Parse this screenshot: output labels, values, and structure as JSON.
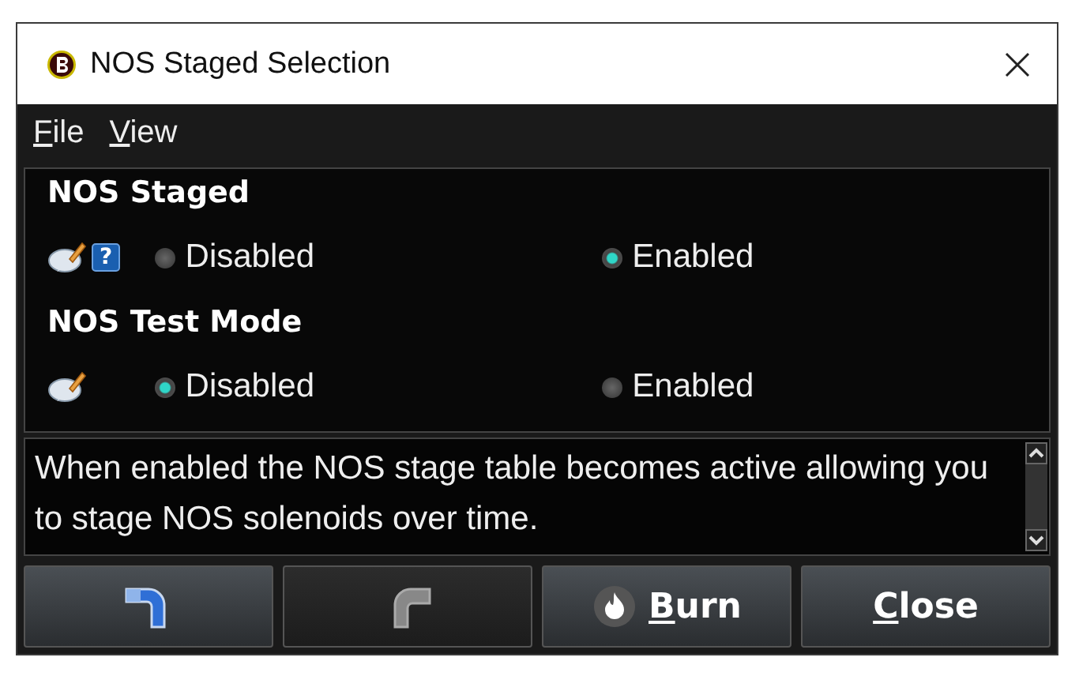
{
  "window": {
    "title": "NOS Staged Selection"
  },
  "menu": [
    {
      "mnemonic": "F",
      "rest": "ile"
    },
    {
      "mnemonic": "V",
      "rest": "iew"
    }
  ],
  "settings": [
    {
      "label": "NOS Staged",
      "has_help": true,
      "help_glyph": "?",
      "options": [
        {
          "label": "Disabled",
          "selected": false
        },
        {
          "label": "Enabled",
          "selected": true
        }
      ]
    },
    {
      "label": "NOS Test Mode",
      "has_help": false,
      "options": [
        {
          "label": "Disabled",
          "selected": true
        },
        {
          "label": "Enabled",
          "selected": false
        }
      ]
    }
  ],
  "help_text": "When enabled the NOS stage table becomes active allowing you to stage NOS solenoids over time.",
  "buttons": [
    {
      "kind": "undo",
      "disabled": false
    },
    {
      "kind": "redo",
      "disabled": true
    },
    {
      "kind": "burn",
      "mnemonic": "B",
      "rest": "urn",
      "disabled": false
    },
    {
      "kind": "close",
      "mnemonic": "C",
      "rest": "lose",
      "disabled": false
    }
  ]
}
